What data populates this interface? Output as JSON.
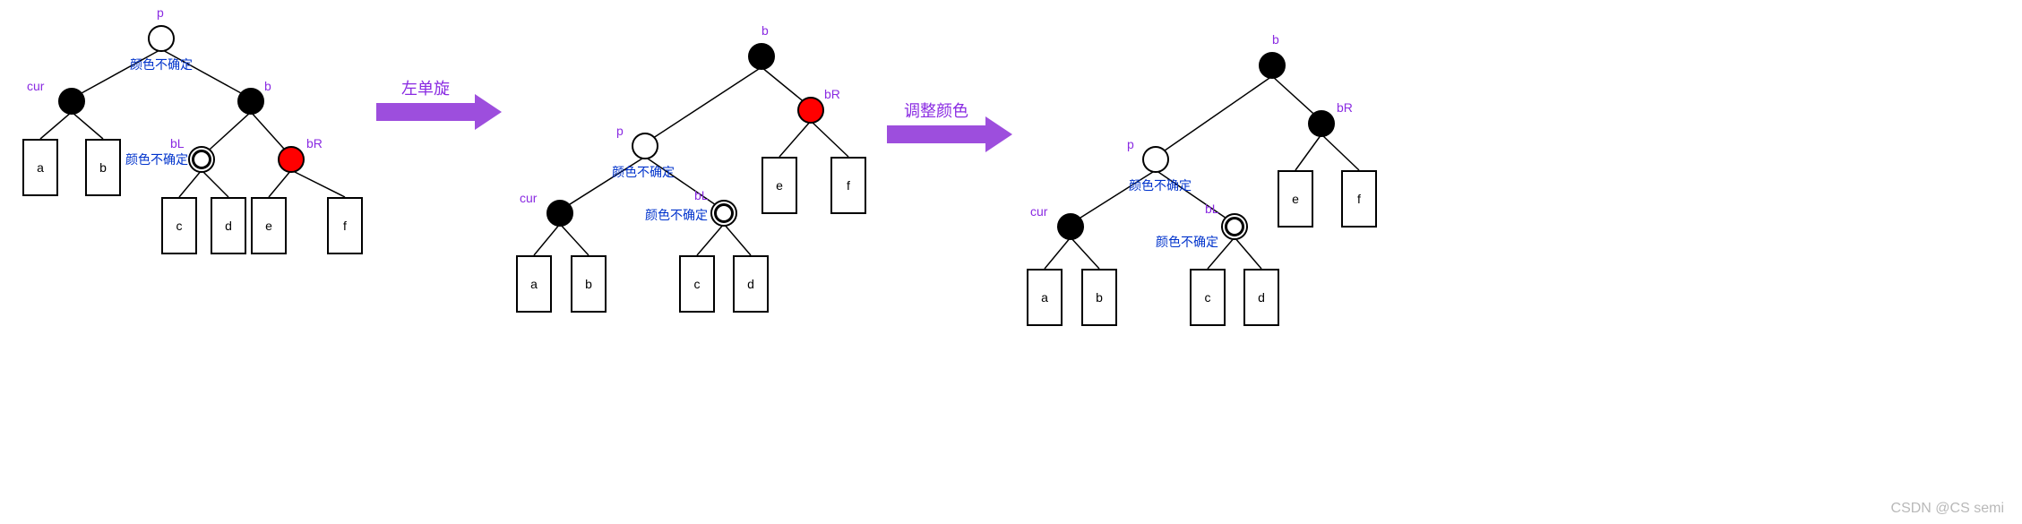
{
  "colors": {
    "red": "#ff0000",
    "black": "#000000",
    "white": "#ffffff",
    "arrow": "#9d4edd",
    "purple_text": "#8a2be2",
    "blue_text": "#0033cc"
  },
  "arrows": [
    {
      "label": "左单旋"
    },
    {
      "label": "调整颜色"
    }
  ],
  "notes": {
    "color_unknown": "颜色不确定"
  },
  "leaf_labels": {
    "a": "a",
    "b": "b",
    "c": "c",
    "d": "d",
    "e": "e",
    "f": "f"
  },
  "node_labels": {
    "p": "p",
    "cur": "cur",
    "b": "b",
    "bL": "bL",
    "bR": "bR"
  },
  "watermark": "CSDN @CS semi",
  "trees": [
    {
      "id": "before",
      "nodes": {
        "p": {
          "color": "white",
          "label": "p",
          "note": "颜色不确定"
        },
        "cur": {
          "color": "black",
          "label": "cur"
        },
        "b": {
          "color": "black",
          "label": "b"
        },
        "bL": {
          "color": "hatched",
          "label": "bL",
          "note": "颜色不确定"
        },
        "bR": {
          "color": "red",
          "label": "bR"
        }
      },
      "edges": [
        [
          "p",
          "cur"
        ],
        [
          "p",
          "b"
        ],
        [
          "cur",
          "a_leaf"
        ],
        [
          "cur",
          "b_leaf"
        ],
        [
          "b",
          "bL"
        ],
        [
          "b",
          "bR"
        ],
        [
          "bL",
          "c_leaf"
        ],
        [
          "bL",
          "d_leaf"
        ],
        [
          "bR",
          "e_leaf"
        ],
        [
          "bR",
          "f_leaf"
        ]
      ],
      "leaves": [
        "a",
        "b",
        "c",
        "d",
        "e",
        "f"
      ]
    },
    {
      "id": "after_rotate",
      "nodes": {
        "b": {
          "color": "black",
          "label": "b"
        },
        "p": {
          "color": "white",
          "label": "p",
          "note": "颜色不确定"
        },
        "bR": {
          "color": "red",
          "label": "bR"
        },
        "cur": {
          "color": "black",
          "label": "cur"
        },
        "bL": {
          "color": "hatched",
          "label": "bL",
          "note": "颜色不确定"
        }
      },
      "edges": [
        [
          "b",
          "p"
        ],
        [
          "b",
          "bR"
        ],
        [
          "p",
          "cur"
        ],
        [
          "p",
          "bL"
        ],
        [
          "bR",
          "e_leaf"
        ],
        [
          "bR",
          "f_leaf"
        ],
        [
          "cur",
          "a_leaf"
        ],
        [
          "cur",
          "b_leaf"
        ],
        [
          "bL",
          "c_leaf"
        ],
        [
          "bL",
          "d_leaf"
        ]
      ],
      "leaves": [
        "a",
        "b",
        "c",
        "d",
        "e",
        "f"
      ]
    },
    {
      "id": "after_recolor",
      "nodes": {
        "b": {
          "color": "black",
          "label": "b"
        },
        "p": {
          "color": "white",
          "label": "p",
          "note": "颜色不确定"
        },
        "bR": {
          "color": "black",
          "label": "bR"
        },
        "cur": {
          "color": "black",
          "label": "cur"
        },
        "bL": {
          "color": "hatched",
          "label": "bL",
          "note": "颜色不确定"
        }
      },
      "edges": [
        [
          "b",
          "p"
        ],
        [
          "b",
          "bR"
        ],
        [
          "p",
          "cur"
        ],
        [
          "p",
          "bL"
        ],
        [
          "bR",
          "e_leaf"
        ],
        [
          "bR",
          "f_leaf"
        ],
        [
          "cur",
          "a_leaf"
        ],
        [
          "cur",
          "b_leaf"
        ],
        [
          "bL",
          "c_leaf"
        ],
        [
          "bL",
          "d_leaf"
        ]
      ],
      "leaves": [
        "a",
        "b",
        "c",
        "d",
        "e",
        "f"
      ]
    }
  ]
}
